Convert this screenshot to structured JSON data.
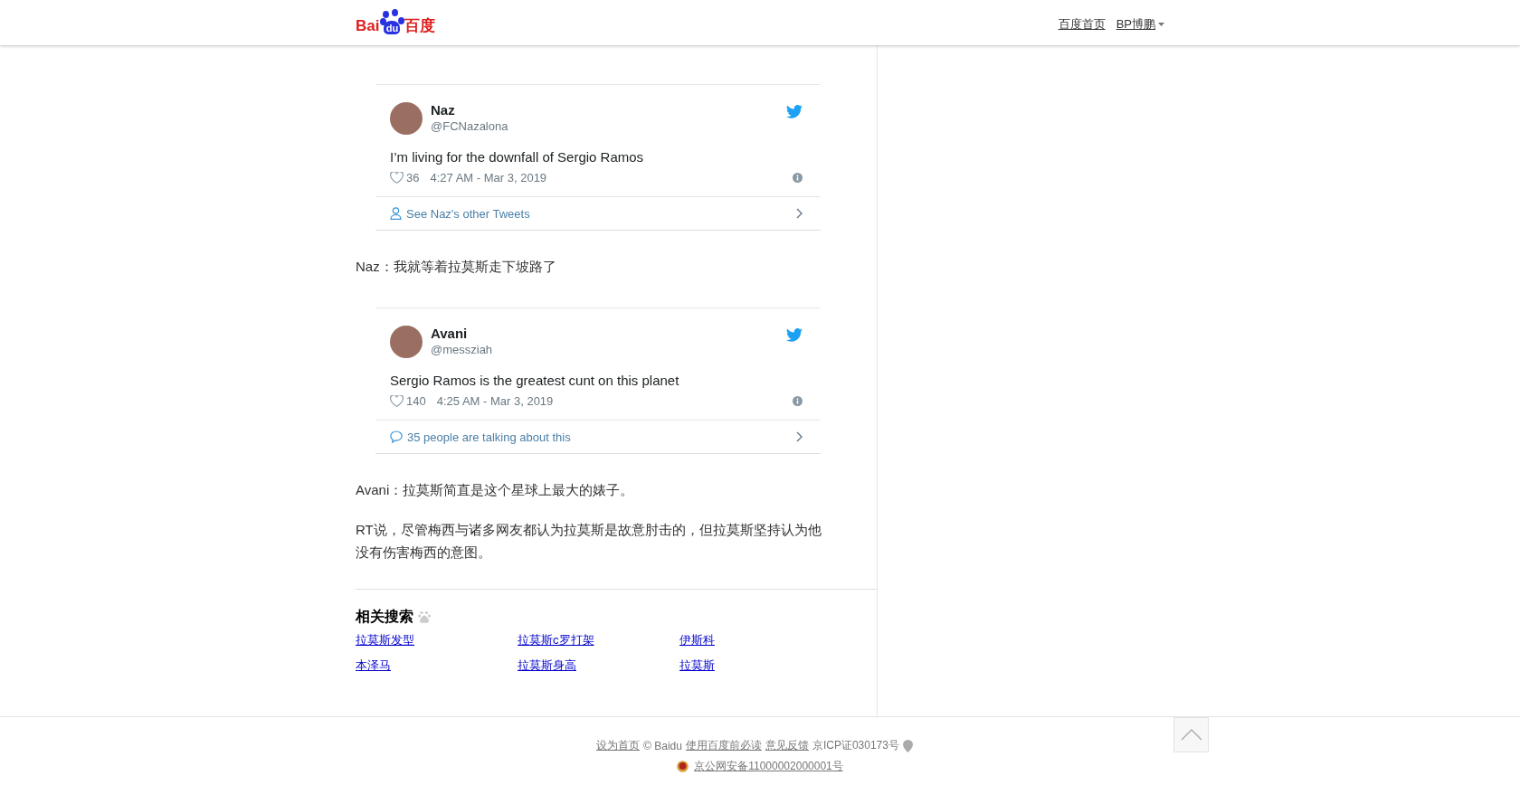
{
  "header": {
    "logo": [
      "Bai",
      "du",
      "百度"
    ],
    "links": [
      {
        "label": "百度首页",
        "has_menu": false
      },
      {
        "label": "BP博鹏",
        "has_menu": true
      }
    ]
  },
  "article": [
    {
      "kind": "tweet",
      "name": "Naz",
      "handle": "@FCNazalona",
      "text": "I’m living for the downfall of Sergio Ramos",
      "likes": "36",
      "time": "4:27 AM - Mar 3, 2019",
      "footer": {
        "kind": "profile",
        "label": "See Naz's other Tweets"
      }
    },
    {
      "kind": "paragraph",
      "text": "Naz：我就等着拉莫斯走下坡路了"
    },
    {
      "kind": "tweet",
      "name": "Avani",
      "handle": "@messziah",
      "text": "Sergio Ramos is the greatest cunt on this planet",
      "likes": "140",
      "time": "4:25 AM - Mar 3, 2019",
      "footer": {
        "kind": "conversation",
        "label": "35 people are talking about this"
      }
    },
    {
      "kind": "paragraph",
      "text": "Avani：拉莫斯简直是这个星球上最大的婊子。"
    },
    {
      "kind": "paragraph",
      "text": "RT说，尽管梅西与诸多网友都认为拉莫斯是故意肘击的，但拉莫斯坚持认为他没有伤害梅西的意图。"
    }
  ],
  "related": {
    "title": "相关搜索",
    "links": [
      "拉莫斯发型",
      "拉莫斯c罗打架",
      "伊斯科",
      "本泽马",
      "拉莫斯身高",
      "拉莫斯"
    ]
  },
  "footer": {
    "line1": [
      {
        "text": "设为首页",
        "link": true
      },
      {
        "text": "© Baidu",
        "link": false
      },
      {
        "text": "使用百度前必读",
        "link": true
      },
      {
        "text": "意见反馈",
        "link": true
      },
      {
        "text": "京ICP证030173号",
        "link": false
      }
    ],
    "record": "京公网安备11000002000001号"
  }
}
